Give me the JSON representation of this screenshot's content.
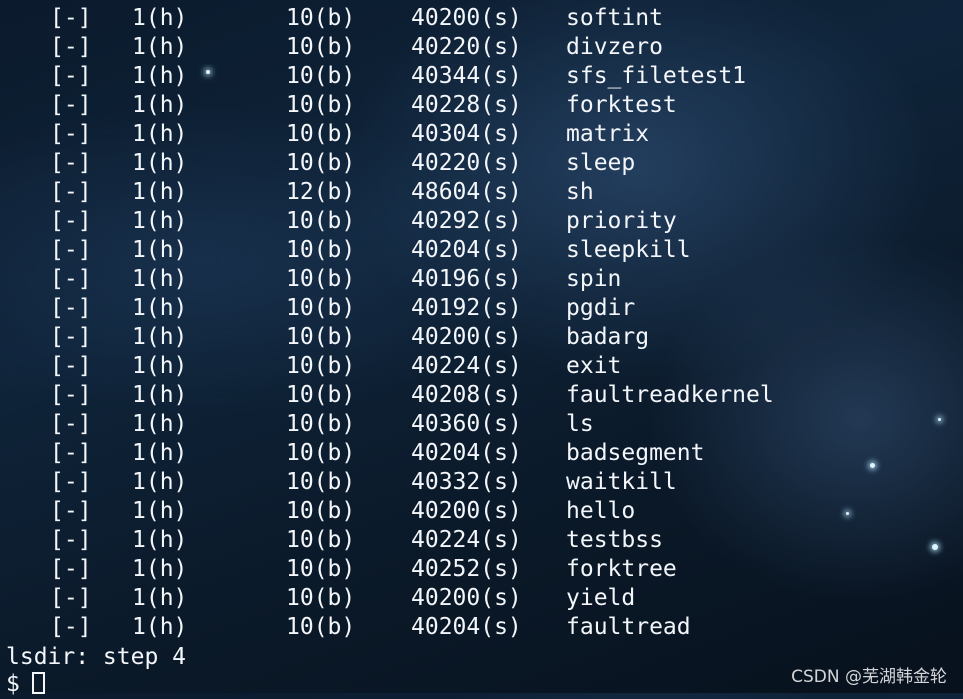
{
  "terminal": {
    "rows": [
      {
        "perm": "[-]",
        "links": "1(h)",
        "blocks": "10(b)",
        "size": "40200(s)",
        "name": "softint"
      },
      {
        "perm": "[-]",
        "links": "1(h)",
        "blocks": "10(b)",
        "size": "40220(s)",
        "name": "divzero"
      },
      {
        "perm": "[-]",
        "links": "1(h)",
        "blocks": "10(b)",
        "size": "40344(s)",
        "name": "sfs_filetest1"
      },
      {
        "perm": "[-]",
        "links": "1(h)",
        "blocks": "10(b)",
        "size": "40228(s)",
        "name": "forktest"
      },
      {
        "perm": "[-]",
        "links": "1(h)",
        "blocks": "10(b)",
        "size": "40304(s)",
        "name": "matrix"
      },
      {
        "perm": "[-]",
        "links": "1(h)",
        "blocks": "10(b)",
        "size": "40220(s)",
        "name": "sleep"
      },
      {
        "perm": "[-]",
        "links": "1(h)",
        "blocks": "12(b)",
        "size": "48604(s)",
        "name": "sh"
      },
      {
        "perm": "[-]",
        "links": "1(h)",
        "blocks": "10(b)",
        "size": "40292(s)",
        "name": "priority"
      },
      {
        "perm": "[-]",
        "links": "1(h)",
        "blocks": "10(b)",
        "size": "40204(s)",
        "name": "sleepkill"
      },
      {
        "perm": "[-]",
        "links": "1(h)",
        "blocks": "10(b)",
        "size": "40196(s)",
        "name": "spin"
      },
      {
        "perm": "[-]",
        "links": "1(h)",
        "blocks": "10(b)",
        "size": "40192(s)",
        "name": "pgdir"
      },
      {
        "perm": "[-]",
        "links": "1(h)",
        "blocks": "10(b)",
        "size": "40200(s)",
        "name": "badarg"
      },
      {
        "perm": "[-]",
        "links": "1(h)",
        "blocks": "10(b)",
        "size": "40224(s)",
        "name": "exit"
      },
      {
        "perm": "[-]",
        "links": "1(h)",
        "blocks": "10(b)",
        "size": "40208(s)",
        "name": "faultreadkernel"
      },
      {
        "perm": "[-]",
        "links": "1(h)",
        "blocks": "10(b)",
        "size": "40360(s)",
        "name": "ls"
      },
      {
        "perm": "[-]",
        "links": "1(h)",
        "blocks": "10(b)",
        "size": "40204(s)",
        "name": "badsegment"
      },
      {
        "perm": "[-]",
        "links": "1(h)",
        "blocks": "10(b)",
        "size": "40332(s)",
        "name": "waitkill"
      },
      {
        "perm": "[-]",
        "links": "1(h)",
        "blocks": "10(b)",
        "size": "40200(s)",
        "name": "hello"
      },
      {
        "perm": "[-]",
        "links": "1(h)",
        "blocks": "10(b)",
        "size": "40224(s)",
        "name": "testbss"
      },
      {
        "perm": "[-]",
        "links": "1(h)",
        "blocks": "10(b)",
        "size": "40252(s)",
        "name": "forktree"
      },
      {
        "perm": "[-]",
        "links": "1(h)",
        "blocks": "10(b)",
        "size": "40200(s)",
        "name": "yield"
      },
      {
        "perm": "[-]",
        "links": "1(h)",
        "blocks": "10(b)",
        "size": "40204(s)",
        "name": "faultread"
      }
    ],
    "status_line": "lsdir: step 4",
    "prompt": "$"
  },
  "watermark": "CSDN @芜湖韩金轮"
}
